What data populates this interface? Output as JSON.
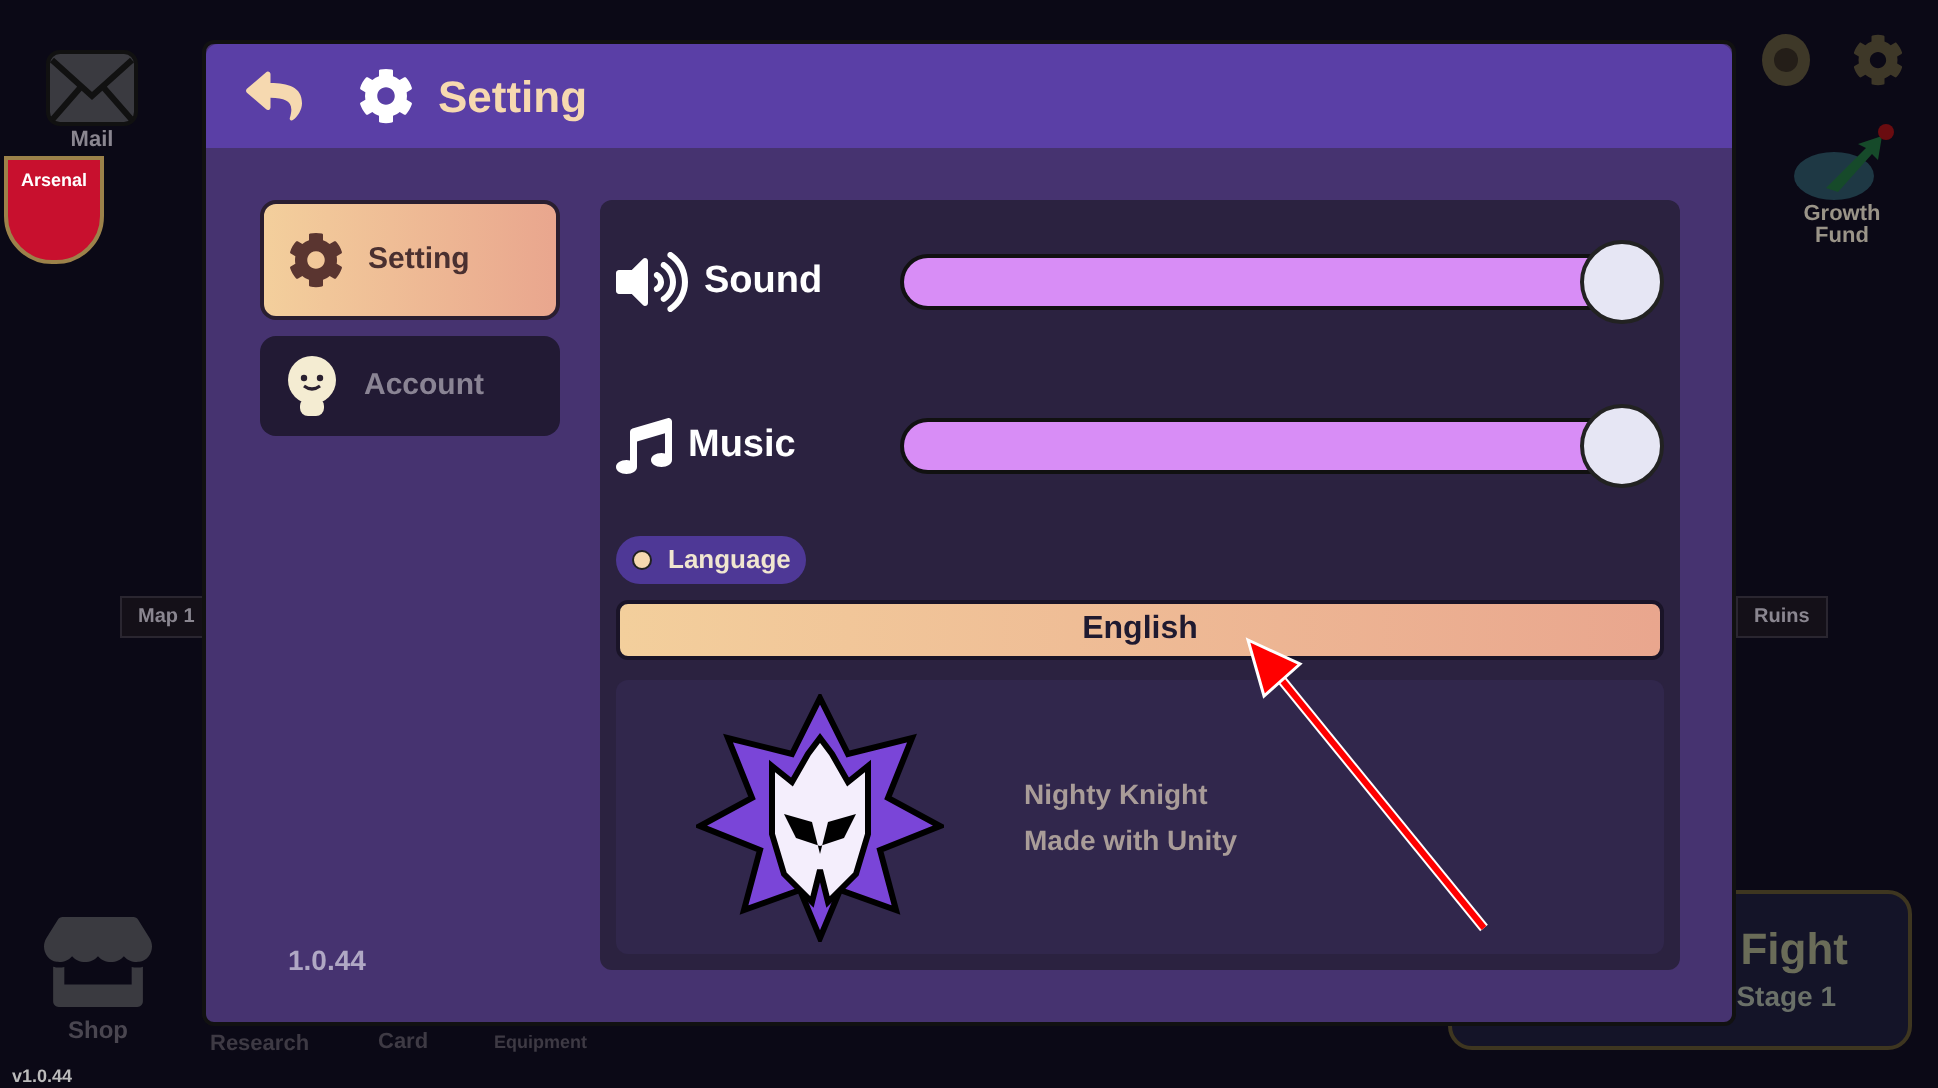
{
  "hud": {
    "mail": "Mail",
    "badge": "Arsenal",
    "map_labels": [
      "Map 1",
      "Ruins"
    ],
    "growth_fund": [
      "Growth",
      "Fund"
    ],
    "nav": [
      "Shop",
      "Research",
      "Card",
      "Equipment"
    ],
    "version": "v1.0.44",
    "battle": {
      "title": "Fight",
      "subtitle": "Stage 1"
    }
  },
  "dialog": {
    "title": "Setting",
    "tabs": [
      {
        "label": "Setting",
        "kind": "setting",
        "selected": true
      },
      {
        "label": "Account",
        "kind": "account",
        "selected": false
      }
    ],
    "version": "1.0.44",
    "sliders": [
      {
        "kind": "sound",
        "label": "Sound",
        "level": 1.0
      },
      {
        "kind": "music",
        "label": "Music",
        "level": 1.0
      }
    ],
    "language": {
      "label": "Language",
      "value": "English"
    },
    "credits": [
      "Nighty Knight",
      "Made with Unity"
    ]
  }
}
